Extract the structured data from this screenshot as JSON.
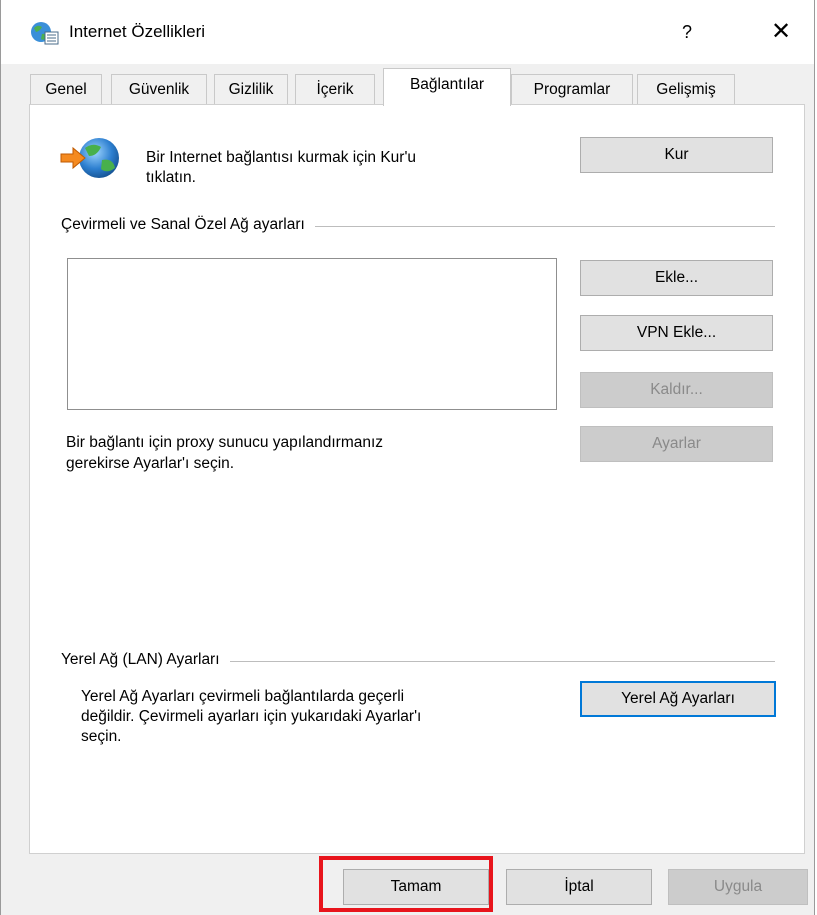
{
  "window": {
    "title": "Internet Özellikleri",
    "help": "?",
    "close": "✕"
  },
  "tabs": [
    {
      "label": "Genel"
    },
    {
      "label": "Güvenlik"
    },
    {
      "label": "Gizlilik"
    },
    {
      "label": "İçerik"
    },
    {
      "label": "Bağlantılar",
      "active": true
    },
    {
      "label": "Programlar"
    },
    {
      "label": "Gelişmiş"
    }
  ],
  "setup": {
    "text_line1": "Bir Internet bağlantısı kurmak için Kur'u",
    "text_line2": "tıklatın.",
    "button": "Kur"
  },
  "dialup": {
    "group_label": "Çevirmeli ve Sanal Özel Ağ ayarları",
    "add_button": "Ekle...",
    "add_vpn_button": "VPN Ekle...",
    "remove_button": "Kaldır...",
    "settings_button": "Ayarlar",
    "proxy_line1": "Bir bağlantı için proxy sunucu yapılandırmanız",
    "proxy_line2": "gerekirse Ayarlar'ı seçin."
  },
  "lan": {
    "group_label": "Yerel Ağ (LAN) Ayarları",
    "text_line1": "Yerel Ağ Ayarları çevirmeli bağlantılarda geçerli",
    "text_line2": "değildir. Çevirmeli ayarları için yukarıdaki Ayarlar'ı",
    "text_line3": "seçin.",
    "button": "Yerel Ağ Ayarları"
  },
  "footer": {
    "ok": "Tamam",
    "cancel": "İptal",
    "apply": "Uygula"
  },
  "colors": {
    "highlight": "#e8141c",
    "focus": "#0078d7"
  }
}
